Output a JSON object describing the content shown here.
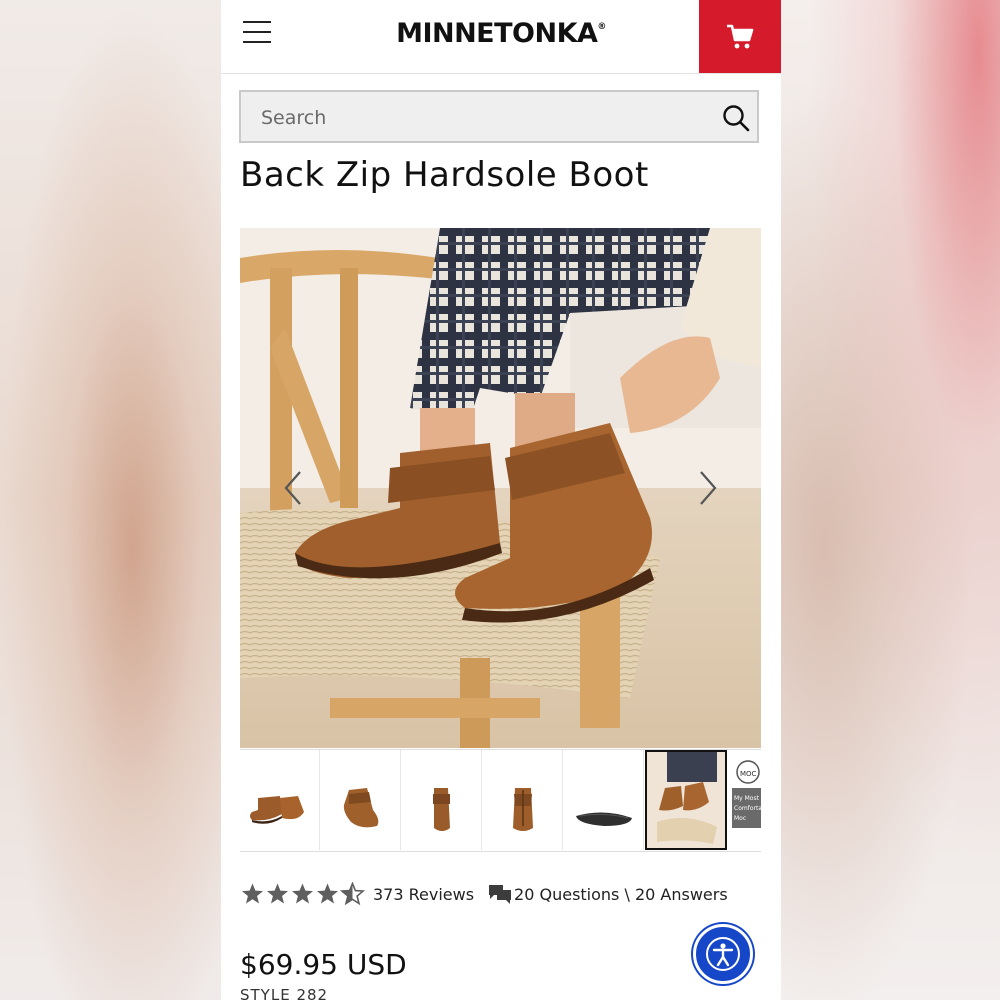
{
  "header": {
    "logo_text": "MINNETONKA",
    "logo_mark": "®",
    "menu_icon": "hamburger-menu-icon",
    "cart_icon": "shopping-cart-icon",
    "cart_color": "#d51a2c"
  },
  "search": {
    "placeholder": "Search",
    "value": "",
    "icon": "search-icon"
  },
  "product": {
    "title": "Back Zip Hardsole Boot",
    "price": "$69.95 USD",
    "style": "STYLE 282",
    "rating": 4.5,
    "rating_max": 5,
    "reviews_label": "373 Reviews",
    "qa_label": "20 Questions \\ 20 Answers",
    "qa_icon": "chat-bubbles-icon"
  },
  "gallery": {
    "prev_icon": "chevron-left-icon",
    "next_icon": "chevron-right-icon",
    "thumbnails": [
      {
        "name": "thumb-boot-side"
      },
      {
        "name": "thumb-boot-back-angle"
      },
      {
        "name": "thumb-boot-front"
      },
      {
        "name": "thumb-boot-back"
      },
      {
        "name": "thumb-boot-sole"
      },
      {
        "name": "thumb-boot-lifestyle",
        "active": true
      },
      {
        "name": "thumb-moc-badge",
        "lettering": [
          "MOC",
          "My Most Comfortable Moc"
        ]
      }
    ]
  },
  "accessibility": {
    "icon": "accessibility-person-icon",
    "color": "#1747c9"
  }
}
